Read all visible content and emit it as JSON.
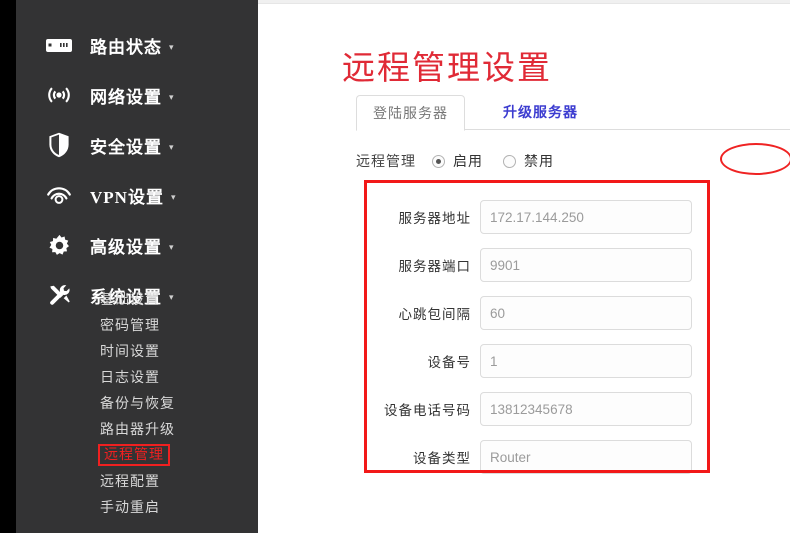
{
  "sidebar": {
    "nav": [
      {
        "label": "路由状态",
        "icon": "router-status-icon",
        "caret": "▾"
      },
      {
        "label": "网络设置",
        "icon": "wifi-signal-icon",
        "caret": "▾"
      },
      {
        "label": "安全设置",
        "icon": "shield-icon",
        "caret": "▾"
      },
      {
        "label": "VPN设置",
        "icon": "vpn-waves-icon",
        "caret": "▾"
      },
      {
        "label": "高级设置",
        "icon": "gear-icon",
        "caret": "▾"
      },
      {
        "label": "系统设置",
        "icon": "tools-wrench-icon",
        "caret": "▾"
      }
    ],
    "submenu": [
      {
        "label": "基础设置",
        "active": false
      },
      {
        "label": "密码管理",
        "active": false
      },
      {
        "label": "时间设置",
        "active": false
      },
      {
        "label": "日志设置",
        "active": false
      },
      {
        "label": "备份与恢复",
        "active": false
      },
      {
        "label": "路由器升级",
        "active": false
      },
      {
        "label": "远程管理",
        "active": true
      },
      {
        "label": "远程配置",
        "active": false
      },
      {
        "label": "手动重启",
        "active": false
      }
    ]
  },
  "main": {
    "title": "远程管理设置",
    "tabs": [
      {
        "label": "登陆服务器",
        "active": true
      },
      {
        "label": "升级服务器",
        "active": false
      }
    ],
    "remote_switch": {
      "label": "远程管理",
      "options": [
        {
          "label": "启用",
          "selected": true
        },
        {
          "label": "禁用",
          "selected": false
        }
      ]
    },
    "form": {
      "fields": [
        {
          "label": "服务器地址",
          "value": "172.17.144.250"
        },
        {
          "label": "服务器端口",
          "value": "9901"
        },
        {
          "label": "心跳包间隔",
          "value": "60"
        },
        {
          "label": "设备号",
          "value": "1"
        },
        {
          "label": "设备电话号码",
          "value": "13812345678"
        },
        {
          "label": "设备类型",
          "value": "Router"
        }
      ]
    }
  },
  "colors": {
    "sidebar_bg": "#333334",
    "title_red": "#e02a36",
    "annotation_red": "#f21818",
    "active_submenu_red": "#f02020",
    "inactive_tab_blue": "#3c3cd0"
  }
}
